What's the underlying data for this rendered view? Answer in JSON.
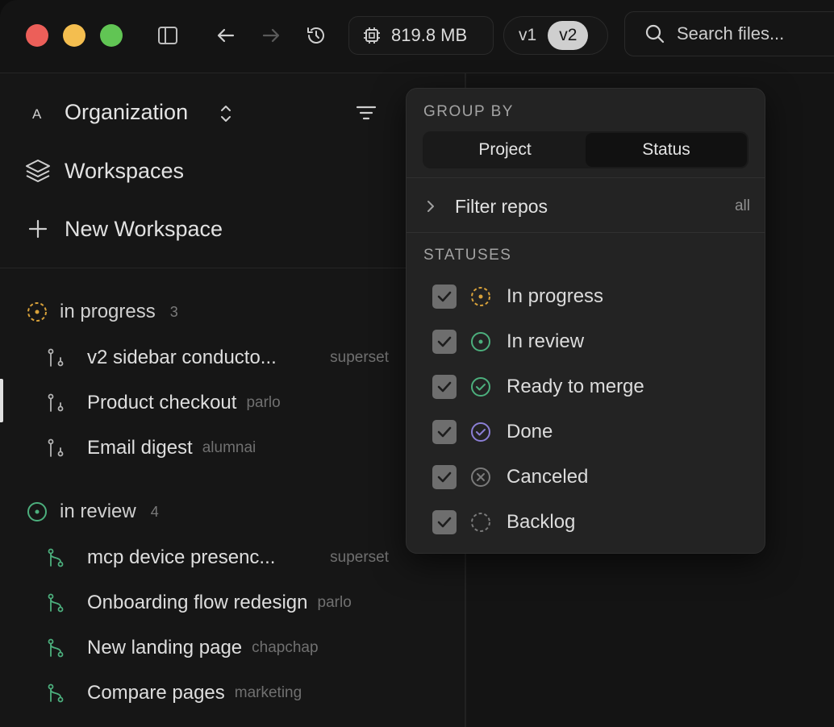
{
  "titlebar": {
    "memory": "819.8 MB",
    "versions": [
      "v1",
      "v2"
    ],
    "active_version": "v2",
    "search_placeholder": "Search files..."
  },
  "sidebar": {
    "org_letter": "A",
    "org_name": "Organization",
    "nav": {
      "workspaces": "Workspaces",
      "new_workspace": "New Workspace"
    },
    "groups": [
      {
        "label": "in progress",
        "count": "3",
        "color": "#d9a23a",
        "items": [
          {
            "name": "v2 sidebar conducto...",
            "repo": "superset"
          },
          {
            "name": "Product checkout",
            "repo": "parlo"
          },
          {
            "name": "Email digest",
            "repo": "alumnai"
          }
        ]
      },
      {
        "label": "in review",
        "count": "4",
        "color": "#4caf7d",
        "items": [
          {
            "name": "mcp device presenc...",
            "repo": "superset"
          },
          {
            "name": "Onboarding flow redesign",
            "repo": "parlo"
          },
          {
            "name": "New landing page",
            "repo": "chapchap"
          },
          {
            "name": "Compare pages",
            "repo": "marketing"
          }
        ]
      }
    ]
  },
  "popover": {
    "group_by_title": "GROUP BY",
    "group_by_options": [
      "Project",
      "Status"
    ],
    "group_by_selected": "Status",
    "filter_repos_label": "Filter repos",
    "filter_repos_value": "all",
    "statuses_title": "STATUSES",
    "statuses": [
      {
        "label": "In progress",
        "checked": true,
        "icon": "in-progress-icon",
        "color": "#d9a23a"
      },
      {
        "label": "In review",
        "checked": true,
        "icon": "in-review-icon",
        "color": "#4caf7d"
      },
      {
        "label": "Ready to merge",
        "checked": true,
        "icon": "ready-to-merge-icon",
        "color": "#4caf7d"
      },
      {
        "label": "Done",
        "checked": true,
        "icon": "done-icon",
        "color": "#8b7fd6"
      },
      {
        "label": "Canceled",
        "checked": true,
        "icon": "canceled-icon",
        "color": "#7a7a7a"
      },
      {
        "label": "Backlog",
        "checked": true,
        "icon": "backlog-icon",
        "color": "#7a7a7a"
      }
    ]
  }
}
